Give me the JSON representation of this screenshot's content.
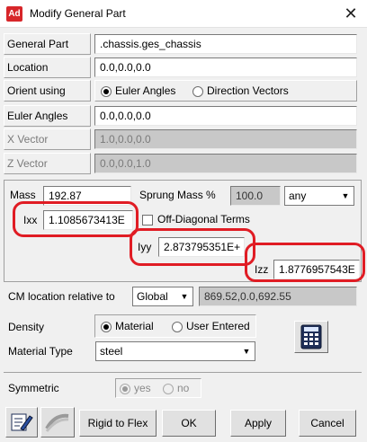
{
  "window": {
    "app_icon_text": "Ad",
    "title": "Modify General Part",
    "close_glyph": "✕"
  },
  "fields": {
    "general_part": {
      "label": "General Part",
      "value": ".chassis.ges_chassis"
    },
    "location": {
      "label": "Location",
      "value": "0.0,0.0,0.0"
    },
    "orient_using": {
      "label": "Orient using",
      "options": [
        "Euler Angles",
        "Direction Vectors"
      ],
      "selected": "Euler Angles"
    },
    "euler_angles": {
      "label": "Euler Angles",
      "value": "0.0,0.0,0.0"
    },
    "x_vector": {
      "label": "X Vector",
      "value": "1.0,0.0,0.0"
    },
    "z_vector": {
      "label": "Z Vector",
      "value": "0.0,0.0,1.0"
    }
  },
  "mass_props": {
    "mass_label": "Mass",
    "mass_value": "192.87",
    "sprung_label": "Sprung Mass %",
    "sprung_value": "100.0",
    "sprung_unit": "any",
    "ixx_label": "Ixx",
    "ixx_value": "1.1085673413E",
    "off_diag_label": "Off-Diagonal Terms",
    "iyy_label": "Iyy",
    "iyy_value": "2.873795351E+",
    "izz_label": "Izz",
    "izz_value": "1.8776957543E"
  },
  "cm": {
    "label": "CM location relative to",
    "frame": "Global",
    "value": "869.52,0.0,692.55"
  },
  "density": {
    "label": "Density",
    "options": [
      "Material",
      "User Entered"
    ],
    "selected": "Material"
  },
  "material_type": {
    "label": "Material Type",
    "value": "steel"
  },
  "symmetric": {
    "label": "Symmetric",
    "options": [
      "yes",
      "no"
    ],
    "selected": "yes"
  },
  "buttons": {
    "rigid_to_flex": "Rigid to Flex",
    "ok": "OK",
    "apply": "Apply",
    "cancel": "Cancel"
  },
  "icons": {
    "calculator": "calculator-icon",
    "edit": "edit-icon",
    "flex": "flex-body-icon"
  },
  "colors": {
    "annotation": "#e01c24",
    "disabled_field": "#c8c8c8"
  }
}
